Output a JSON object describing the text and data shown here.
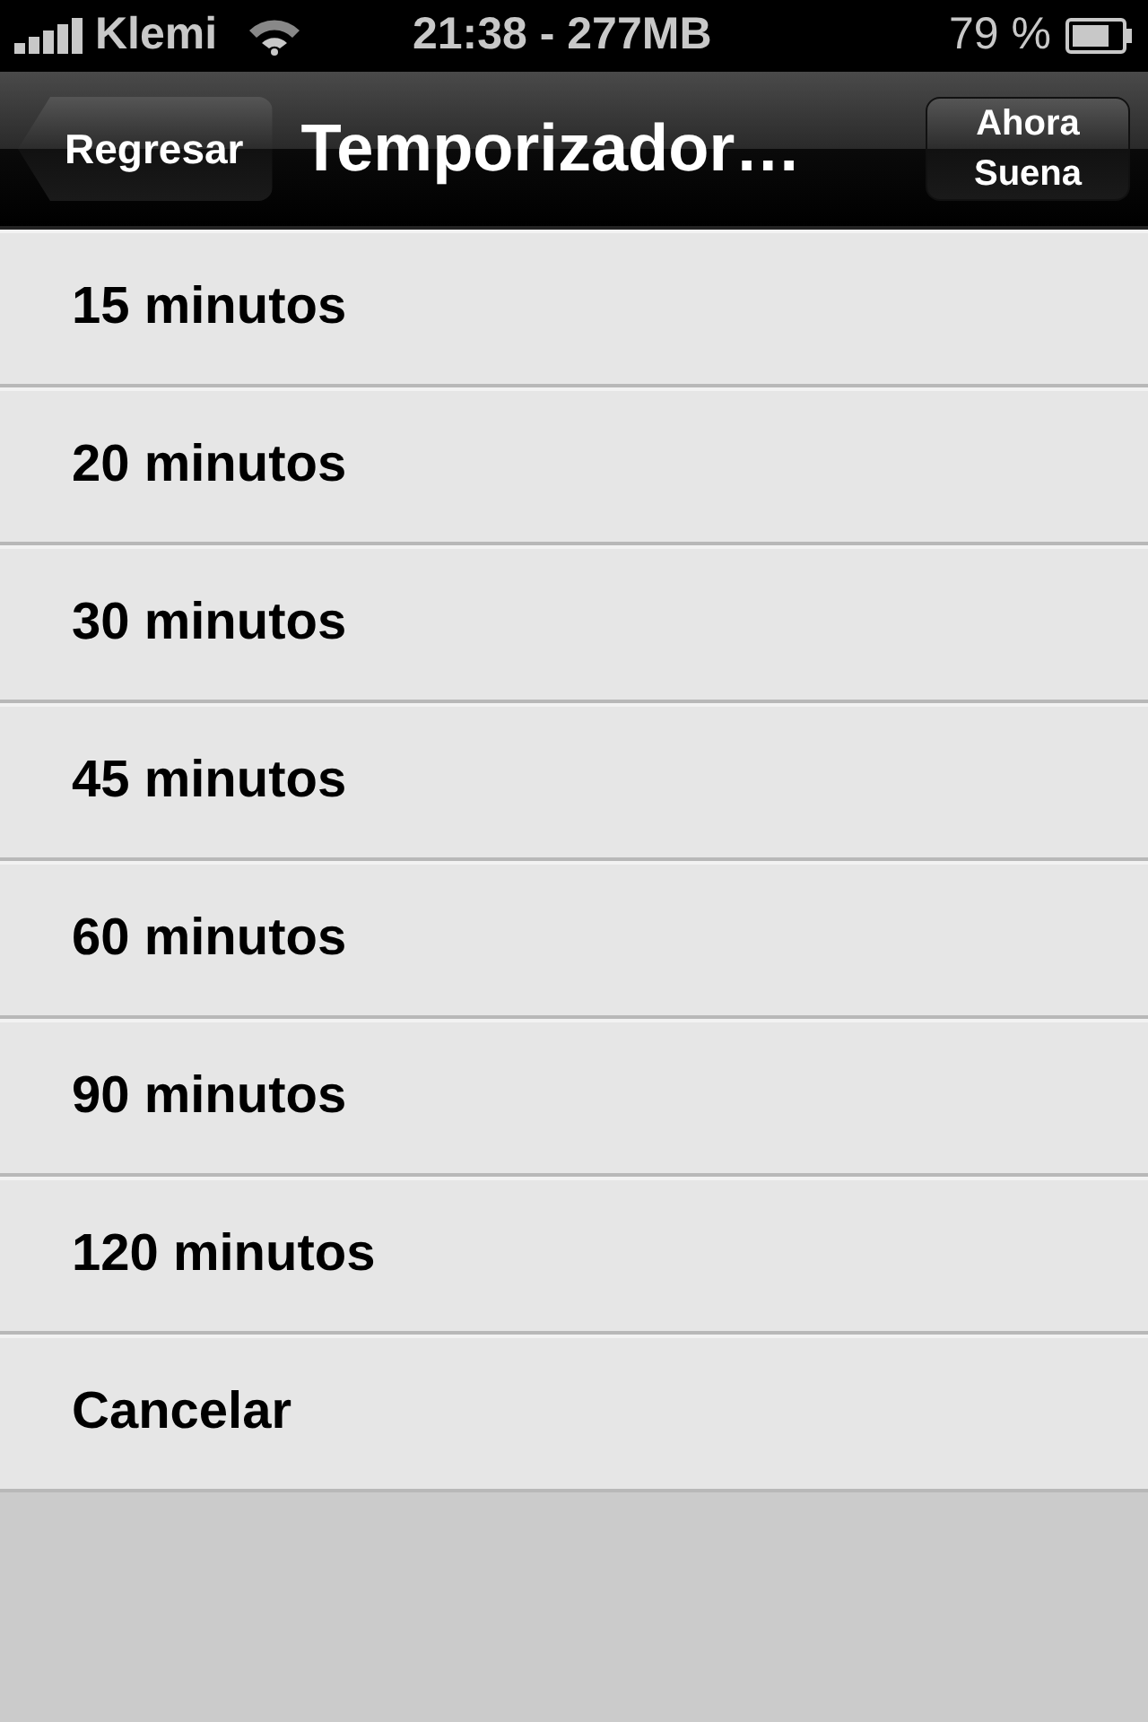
{
  "status_bar": {
    "carrier": "Klemi",
    "time": "21:38 - 277MB",
    "battery": "79 %"
  },
  "nav_bar": {
    "back": "Regresar",
    "title": "Temporizador…",
    "right_button": [
      "Ahora",
      "Suena"
    ]
  },
  "options": [
    {
      "label": "15 minutos"
    },
    {
      "label": "20 minutos"
    },
    {
      "label": "30 minutos"
    },
    {
      "label": "45 minutos"
    },
    {
      "label": "60 minutos"
    },
    {
      "label": "90 minutos"
    },
    {
      "label": "120 minutos"
    },
    {
      "label": "Cancelar"
    }
  ]
}
